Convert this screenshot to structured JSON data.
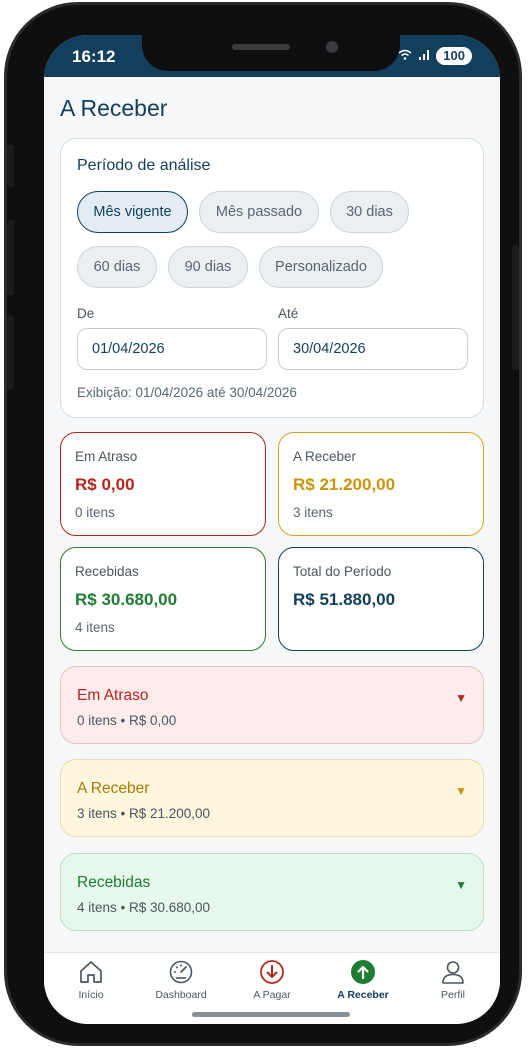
{
  "status": {
    "time": "16:12",
    "battery": "100"
  },
  "page": {
    "title": "A Receber"
  },
  "periodo": {
    "title": "Período de análise",
    "chips": [
      "Mês vigente",
      "Mês passado",
      "30 dias",
      "60 dias",
      "90 dias",
      "Personalizado"
    ],
    "active_chip": "Mês vigente",
    "de_label": "De",
    "ate_label": "Até",
    "de_value": "01/04/2026",
    "ate_value": "30/04/2026",
    "exibicao": "Exibição: 01/04/2026 até 30/04/2026"
  },
  "stats": [
    {
      "label": "Em Atraso",
      "value": "R$ 0,00",
      "sub": "0 itens",
      "color": "#b3261e",
      "border": "#b3261e"
    },
    {
      "label": "A Receber",
      "value": "R$ 21.200,00",
      "sub": "3 itens",
      "color": "#c8960a",
      "border": "#d8a520"
    },
    {
      "label": "Recebidas",
      "value": "R$ 30.680,00",
      "sub": "4 itens",
      "color": "#1e7d32",
      "border": "#2e7d32"
    },
    {
      "label": "Total do Período",
      "value": "R$ 51.880,00",
      "sub": "",
      "color": "#123f5c",
      "border": "#123f5c"
    }
  ],
  "sections": [
    {
      "title": "Em Atraso",
      "summary": "0 itens • R$ 0,00",
      "title_color": "#b3261e",
      "bg": "#fdecec",
      "border": "#e8c2c2",
      "arrow": "▼"
    },
    {
      "title": "A Receber",
      "summary": "3 itens • R$ 21.200,00",
      "title_color": "#a87c08",
      "bg": "#fdf5dc",
      "border": "#ecdcae",
      "arrow": "▼"
    },
    {
      "title": "Recebidas",
      "summary": "4 itens • R$ 30.680,00",
      "title_color": "#1e7d32",
      "bg": "#e6f7eb",
      "border": "#bfe1c8",
      "arrow": "▼"
    }
  ],
  "nav": [
    {
      "label": "Início",
      "icon": "home-icon"
    },
    {
      "label": "Dashboard",
      "icon": "gauge-icon"
    },
    {
      "label": "A Pagar",
      "icon": "arrow-down-circle-icon"
    },
    {
      "label": "A Receber",
      "icon": "arrow-up-circle-icon"
    },
    {
      "label": "Perfil",
      "icon": "user-icon"
    }
  ],
  "colors": {
    "primary": "#123f5c",
    "danger": "#b3261e",
    "warning": "#c8960a",
    "success": "#1e7d32"
  }
}
